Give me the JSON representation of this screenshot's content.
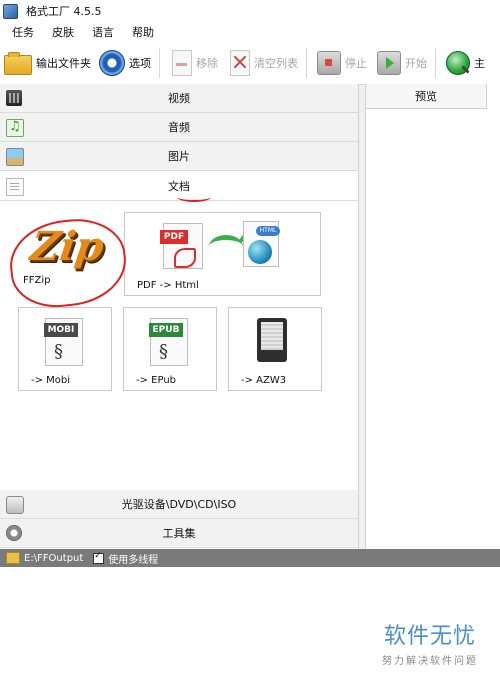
{
  "window": {
    "title": "格式工厂 4.5.5"
  },
  "menu": [
    {
      "label": "任务"
    },
    {
      "label": "皮肤"
    },
    {
      "label": "语言"
    },
    {
      "label": "帮助"
    }
  ],
  "toolbar": {
    "output_folder": "输出文件夹",
    "options": "选项",
    "remove": "移除",
    "clear_list": "清空列表",
    "stop": "停止",
    "start": "开始",
    "home": "主"
  },
  "categories": {
    "video": "视频",
    "audio": "音频",
    "image": "图片",
    "document": "文档",
    "disc": "光驱设备\\DVD\\CD\\ISO",
    "tools": "工具集"
  },
  "document_tools": [
    {
      "label": "FFZip"
    },
    {
      "label": "PDF -> Html"
    },
    {
      "label": "-> Mobi",
      "badge": "MOBI"
    },
    {
      "label": "-> EPub",
      "badge": "EPUB"
    },
    {
      "label": "-> AZW3"
    }
  ],
  "preview": {
    "header": "预览"
  },
  "status": {
    "output_path": "E:\\FFOutput",
    "multithread_label": "使用多线程",
    "multithread_checked": true
  },
  "watermark": {
    "main": "软件无忧",
    "sub": "努力解决软件问题"
  }
}
